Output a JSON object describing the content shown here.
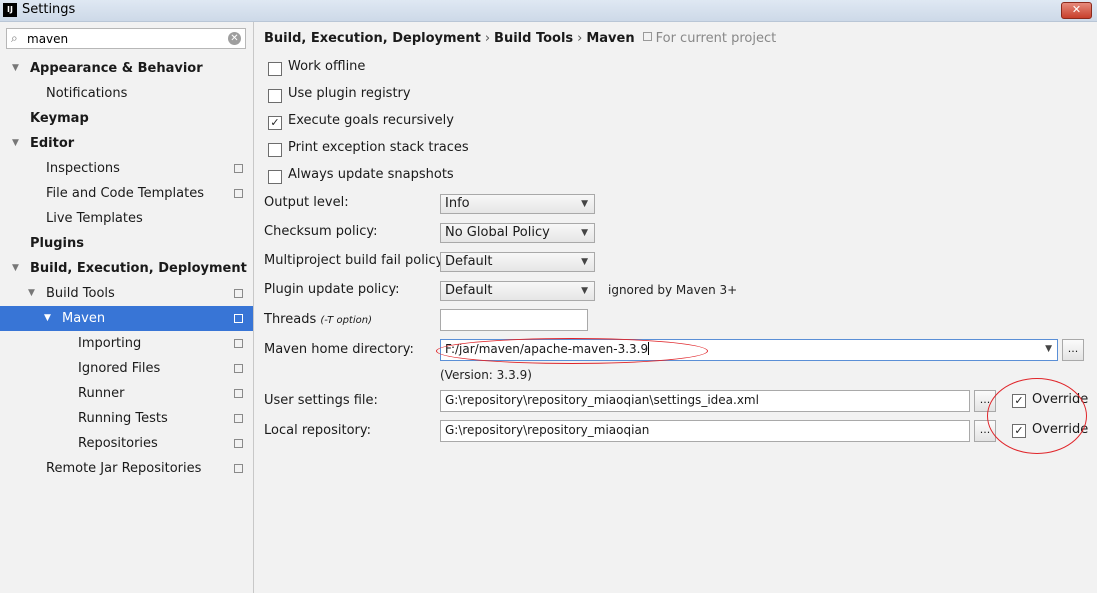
{
  "window": {
    "title": "Settings",
    "logo_text": "IJ",
    "close_glyph": "✕"
  },
  "search": {
    "value": "maven",
    "icon": "magnifier",
    "clear_glyph": "✕"
  },
  "sidebar": {
    "items": [
      {
        "label": "Appearance & Behavior",
        "expanded": true
      },
      {
        "label": "Notifications"
      },
      {
        "label": "Keymap"
      },
      {
        "label": "Editor",
        "expanded": true
      },
      {
        "label": "Inspections"
      },
      {
        "label": "File and Code Templates"
      },
      {
        "label": "Live Templates"
      },
      {
        "label": "Plugins"
      },
      {
        "label": "Build, Execution, Deployment",
        "expanded": true
      },
      {
        "label": "Build Tools",
        "expanded": true
      },
      {
        "label": "Maven",
        "expanded": true,
        "selected": true
      },
      {
        "label": "Importing"
      },
      {
        "label": "Ignored Files"
      },
      {
        "label": "Runner"
      },
      {
        "label": "Running Tests"
      },
      {
        "label": "Repositories"
      },
      {
        "label": "Remote Jar Repositories"
      }
    ]
  },
  "breadcrumb": {
    "parts": [
      "Build, Execution, Deployment",
      "Build Tools",
      "Maven"
    ],
    "separator": "›",
    "scope_note": "For current project"
  },
  "options": {
    "work_offline": {
      "label": "Work offline",
      "checked": false
    },
    "use_plugin_registry": {
      "label": "Use plugin registry",
      "checked": false
    },
    "execute_goals_recursively": {
      "label": "Execute goals recursively",
      "checked": true
    },
    "print_exception_stack_traces": {
      "label": "Print exception stack traces",
      "checked": false
    },
    "always_update_snapshots": {
      "label": "Always update snapshots",
      "checked": false
    }
  },
  "form": {
    "output_level": {
      "label": "Output level:",
      "value": "Info"
    },
    "checksum_policy": {
      "label": "Checksum policy:",
      "value": "No Global Policy"
    },
    "multiproject_fail_policy": {
      "label": "Multiproject build fail policy:",
      "value": "Default"
    },
    "plugin_update_policy": {
      "label": "Plugin update policy:",
      "value": "Default",
      "hint": "ignored by Maven 3+"
    },
    "threads": {
      "label": "Threads",
      "sub": "(-T option)",
      "value": ""
    },
    "maven_home": {
      "label": "Maven home directory:",
      "value": "F:/jar/maven/apache-maven-3.3.9",
      "version": "(Version: 3.3.9)"
    },
    "user_settings": {
      "label": "User settings file:",
      "value": "G:\\repository\\repository_miaoqian\\settings_idea.xml",
      "override_label": "Override",
      "override": true
    },
    "local_repository": {
      "label": "Local repository:",
      "value": "G:\\repository\\repository_miaoqian",
      "override_label": "Override",
      "override": true
    },
    "browse_label": "..."
  },
  "colors": {
    "selection": "#3875d6",
    "annotation": "#e0252a"
  }
}
